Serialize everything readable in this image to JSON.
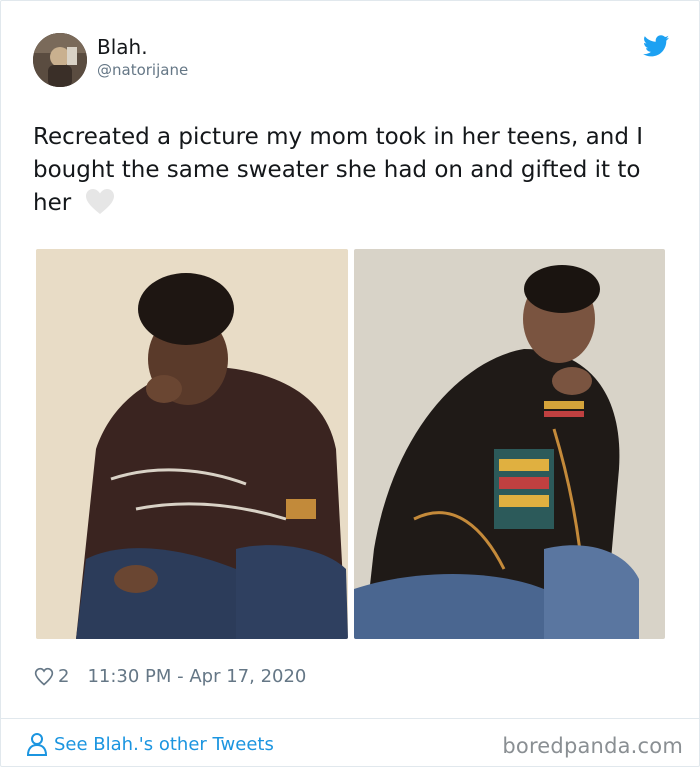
{
  "tweet": {
    "author_name": "Blah.",
    "author_handle": "@natorijane",
    "text": "Recreated a picture my mom took in her teens, and I bought the same sweater she had on and gifted it to her",
    "like_count": "2",
    "timestamp": "11:30 PM - Apr 17, 2020",
    "see_more_label": "See Blah.'s other Tweets"
  },
  "photos": [
    {
      "icon": "vintage-photo-mom"
    },
    {
      "icon": "recreated-photo-daughter"
    }
  ],
  "watermark": "boredpanda.com",
  "colors": {
    "accent": "#1b95e0",
    "twitter_blue": "#1da1f2",
    "muted": "#657786",
    "text": "#14171a",
    "border": "#e1e8ed"
  }
}
